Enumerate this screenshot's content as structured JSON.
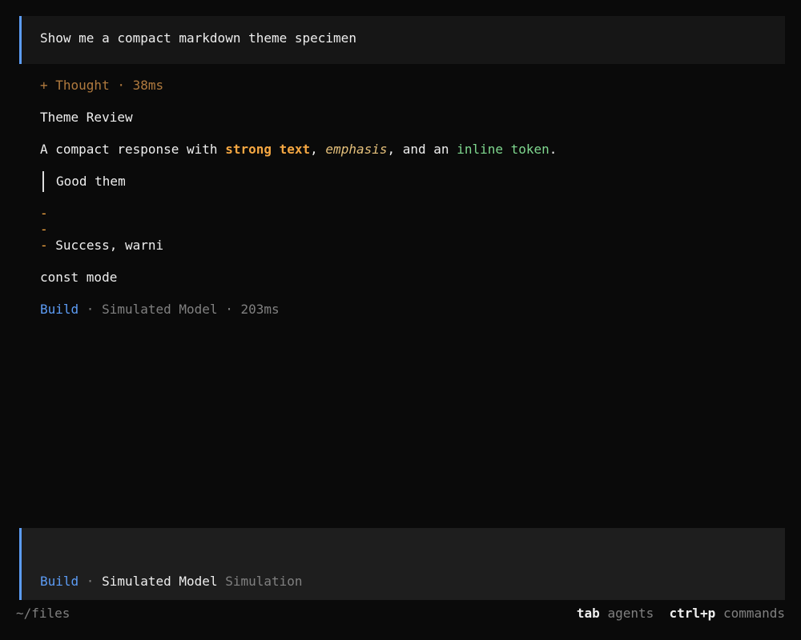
{
  "user_prompt": "Show me a compact markdown theme specimen",
  "thought": {
    "label": "+ Thought",
    "separator": " · ",
    "duration": "38ms"
  },
  "response": {
    "heading": "Theme Review",
    "paragraph": {
      "prefix": "A compact response with ",
      "strong": "strong text",
      "sep1": ", ",
      "emphasis": "emphasis",
      "sep2": ", and an ",
      "code": "inline token",
      "suffix": "."
    },
    "blockquote": "Good them",
    "bullets": [
      {
        "marker": "-",
        "text": ""
      },
      {
        "marker": "-",
        "text": ""
      },
      {
        "marker": "-",
        "text": "Success, warni"
      }
    ],
    "code_line": "const mode"
  },
  "message_status": {
    "mode": "Build",
    "separator": " · ",
    "model": "Simulated Model",
    "separator2": " · ",
    "duration": "203ms"
  },
  "input_status": {
    "mode": "Build",
    "separator": " · ",
    "model": "Simulated Model",
    "provider": "Simulation"
  },
  "footer": {
    "path": "~/files",
    "hints": [
      {
        "key": "tab",
        "label": "agents"
      },
      {
        "key": "ctrl+p",
        "label": "commands"
      }
    ]
  },
  "colors": {
    "accent": "#5c9cf5",
    "strong": "#f5a742",
    "emphasis": "#e5c07b",
    "code": "#7fd88f",
    "thought": "#b07a3e",
    "muted": "#808080",
    "background": "#0a0a0a"
  }
}
